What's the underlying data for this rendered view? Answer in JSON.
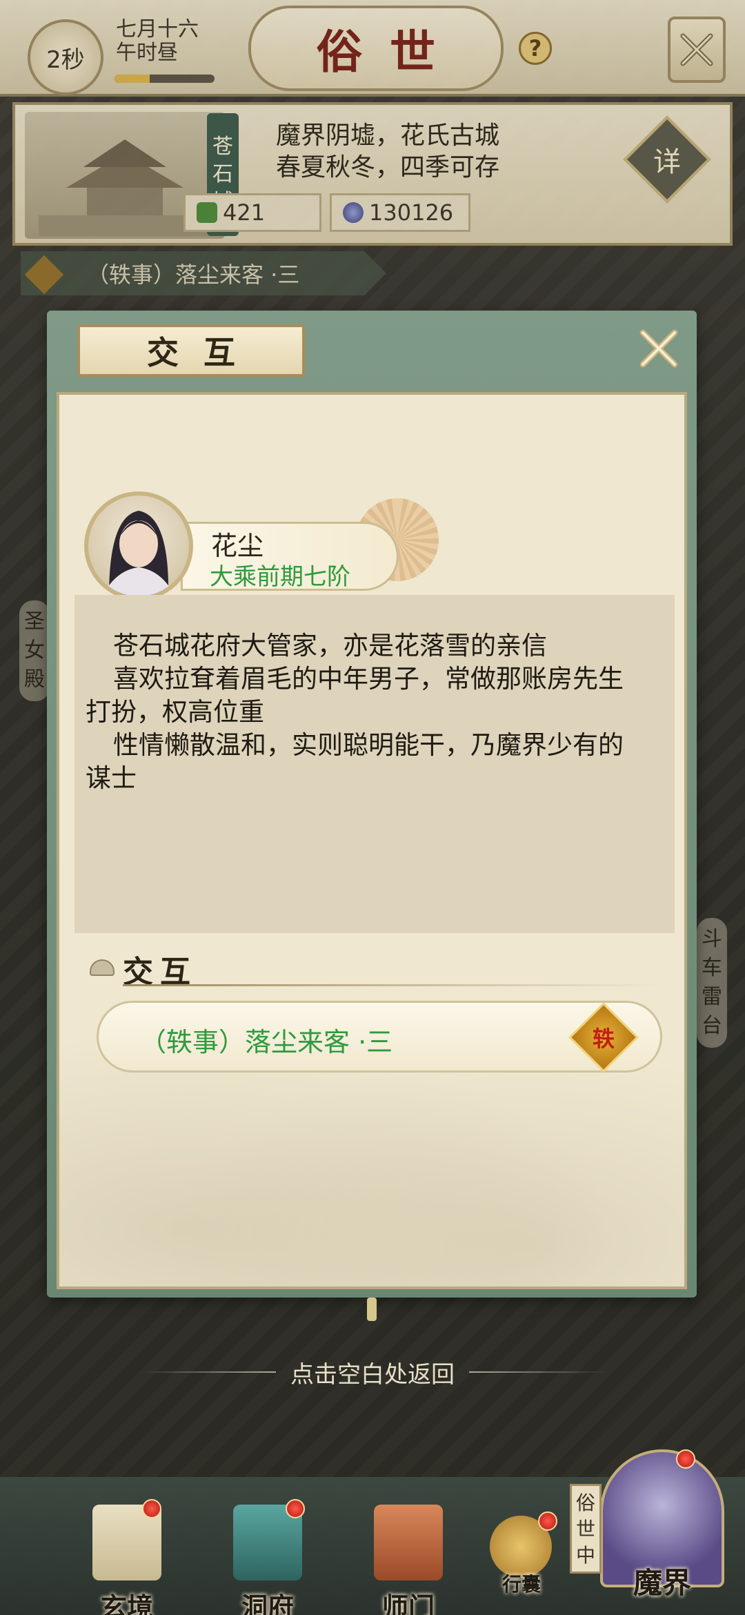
{
  "topbar": {
    "timer": "2秒",
    "date_line1": "七月十六",
    "date_line2": "午时昼",
    "day_progress": 0.35,
    "title": "俗世",
    "help": "?"
  },
  "location": {
    "name": "苍石城",
    "name_chars": [
      "苍",
      "石",
      "城"
    ],
    "desc_line1": "魔界阴墟，花氏古城",
    "desc_line2": "春夏秋冬，四季可存",
    "detail_label": "详",
    "resource1": "421",
    "resource2": "130126"
  },
  "map": {
    "quest_tag_icon": "轶",
    "quest_tag": "（轶事）落尘来客 ·三",
    "left_building": [
      "圣",
      "女",
      "殿"
    ],
    "right_building": [
      "斗",
      "车",
      "雷",
      "台"
    ]
  },
  "dialog": {
    "title": "交互",
    "npc": {
      "name": "花尘",
      "rank": "大乘前期七阶"
    },
    "description": [
      "苍石城花府大管家，亦是花落雪的亲信",
      "喜欢拉耷着眉毛的中年男子，常做那账房先生",
      "打扮，权高位重",
      "性情懒散温和，实则聪明能干，乃魔界少有的",
      "谋士"
    ],
    "section_title": "交互",
    "interaction": {
      "label": "（轶事）落尘来客 ·三",
      "badge": "轶"
    }
  },
  "return_hint": "点击空白处返回",
  "nav": {
    "items": [
      "玄境",
      "洞府",
      "师门",
      "行囊"
    ],
    "realm_label": "魔界",
    "realm_tag": [
      "俗",
      "世",
      "中"
    ]
  },
  "colors": {
    "rank_green": "#2f9a3e",
    "title_red": "#7a2218",
    "dialog_frame": "#7f9a86"
  }
}
